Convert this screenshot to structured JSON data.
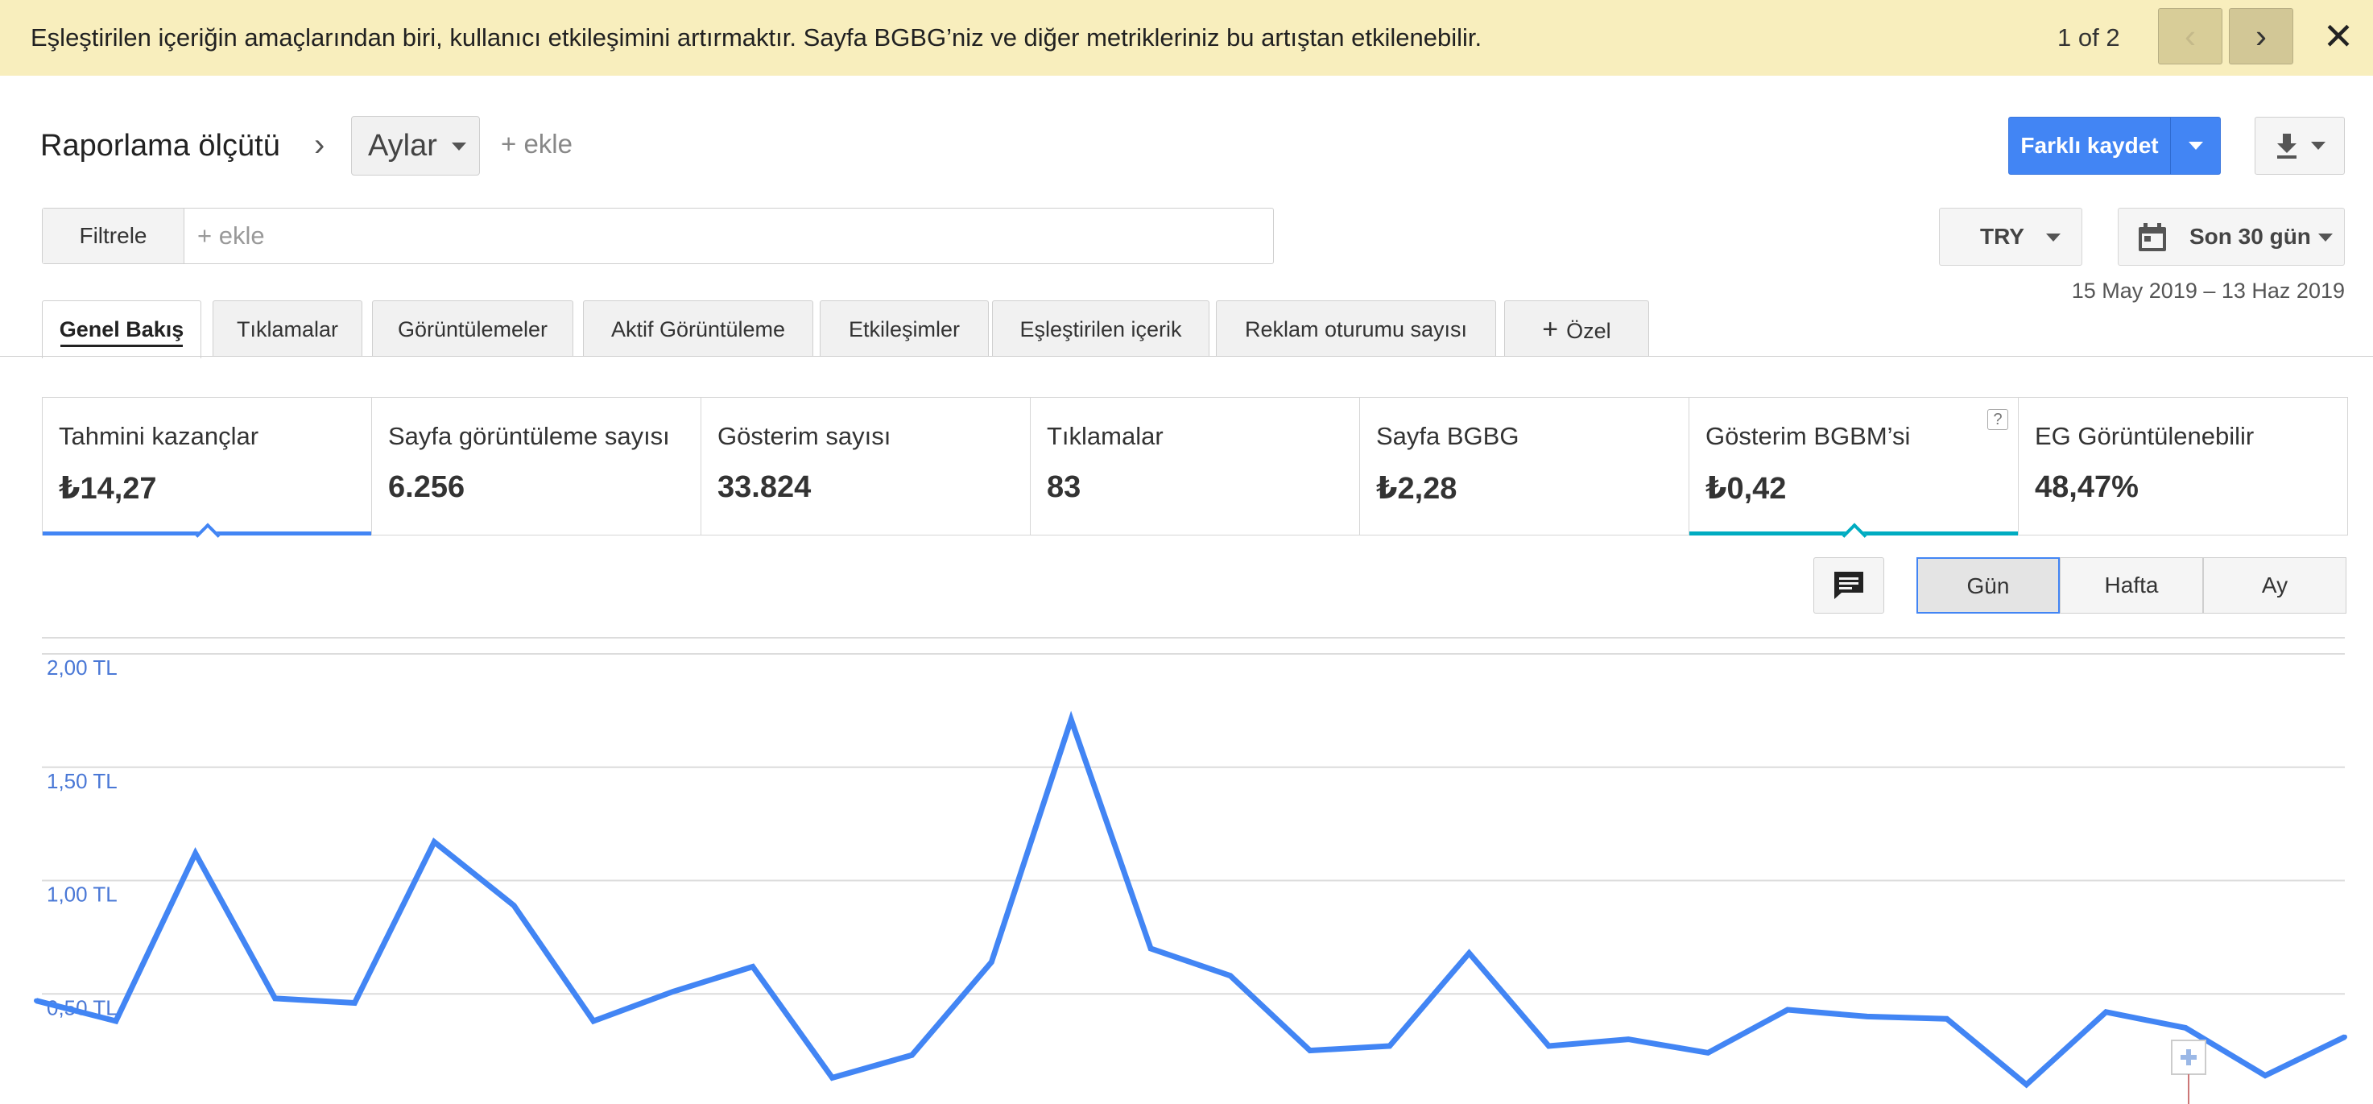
{
  "banner": {
    "message": "Eşleştirilen içeriğin amaçlarından biri, kullanıcı etkileşimini artırmaktır. Sayfa BGBG’niz ve diğer metrikleriniz bu artıştan etkilenebilir.",
    "counter": "1 of 2",
    "prev_icon": "chevron-left-icon",
    "next_icon": "chevron-right-icon",
    "prev_glyph": "‹",
    "next_glyph": "›",
    "close_glyph": "✕"
  },
  "report": {
    "label": "Raporlama ölçütü",
    "chevron": "›",
    "dimension": "Aylar",
    "add": "+ ekle"
  },
  "toolbar": {
    "save_label": "Farklı kaydet",
    "download_icon": "download-icon"
  },
  "filter": {
    "label": "Filtrele",
    "placeholder": "+ ekle"
  },
  "currency": "TRY",
  "date": {
    "label": "Son 30 gün",
    "range": "15 May 2019 – 13 Haz 2019"
  },
  "tabs": [
    {
      "label": "Genel Bakış",
      "active": true
    },
    {
      "label": "Tıklamalar"
    },
    {
      "label": "Görüntülemeler"
    },
    {
      "label": "Aktif Görüntüleme"
    },
    {
      "label": "Etkileşimler"
    },
    {
      "label": "Eşleştirilen içerik"
    },
    {
      "label": "Reklam oturumu sayısı"
    },
    {
      "label": "Özel",
      "icon": "plus-icon",
      "glyph": "+"
    }
  ],
  "metrics": [
    {
      "label": "Tahmini kazançlar",
      "value": "₺14,27",
      "selected": true,
      "color": "#4285f4"
    },
    {
      "label": "Sayfa görüntüleme sayısı",
      "value": "6.256"
    },
    {
      "label": "Gösterim sayısı",
      "value": "33.824"
    },
    {
      "label": "Tıklamalar",
      "value": "83"
    },
    {
      "label": "Sayfa BGBG",
      "value": "₺2,28"
    },
    {
      "label": "Gösterim BGBM’si",
      "value": "₺0,42",
      "selected": true,
      "color": "#00acc1",
      "help": "?"
    },
    {
      "label": "EG Görüntülenebilir",
      "value": "48,47%"
    }
  ],
  "granularity": {
    "options": [
      "Gün",
      "Hafta",
      "Ay"
    ],
    "selected": "Gün",
    "comment_icon": "comment-icon"
  },
  "colors": {
    "accent": "#4285f4",
    "banner_bg": "#f8eebd",
    "secondary": "#00acc1"
  },
  "chart_data": {
    "type": "line",
    "series": [
      {
        "color": "#4285f4",
        "values": [
          0.47,
          0.38,
          1.12,
          0.48,
          0.46,
          1.17,
          0.89,
          0.38,
          0.51,
          0.62,
          0.13,
          0.23,
          0.64,
          1.71,
          0.7,
          0.58,
          0.25,
          0.27,
          0.68,
          0.27,
          0.3,
          0.24,
          0.43,
          0.4,
          0.39,
          0.1,
          0.42,
          0.35,
          0.14,
          0.31
        ]
      }
    ],
    "y_ticks": [
      "2,00 TL",
      "1,50 TL",
      "1,00 TL",
      "0,50 TL"
    ],
    "y_tick_values": [
      2.0,
      1.5,
      1.0,
      0.5
    ],
    "ylim": [
      0,
      2.0
    ],
    "grid": true
  }
}
